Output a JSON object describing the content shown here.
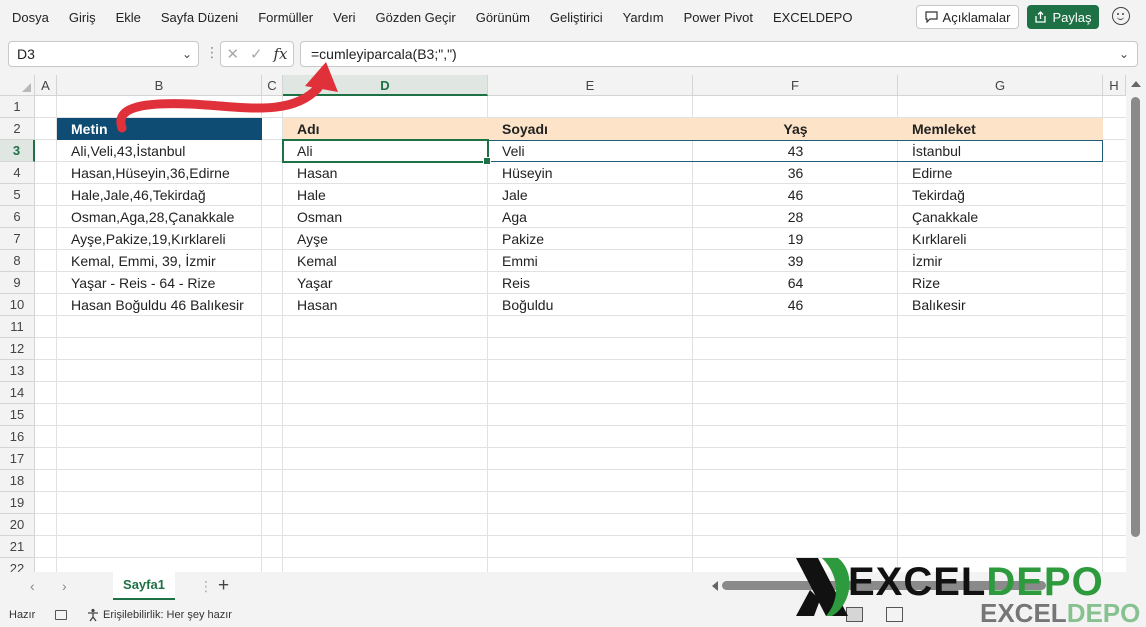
{
  "menu": [
    "Dosya",
    "Giriş",
    "Ekle",
    "Sayfa Düzeni",
    "Formüller",
    "Veri",
    "Gözden Geçir",
    "Görünüm",
    "Geliştirici",
    "Yardım",
    "Power Pivot",
    "EXCELDEPO"
  ],
  "header_buttons": {
    "comments": "Açıklamalar",
    "share": "Paylaş"
  },
  "formula_bar": {
    "name_box": "D3",
    "formula": "=cumleyiparcala(B3;\",\")",
    "fx_label": "fx"
  },
  "columns": [
    "A",
    "B",
    "C",
    "D",
    "E",
    "F",
    "G",
    "H"
  ],
  "rows": [
    "1",
    "2",
    "3",
    "4",
    "5",
    "6",
    "7",
    "8",
    "9",
    "10",
    "11",
    "12",
    "13",
    "14",
    "15",
    "16",
    "17",
    "18",
    "19",
    "20",
    "21",
    "22"
  ],
  "selected_cell": {
    "column": "D",
    "row": "3"
  },
  "source_header": "Metin",
  "source_rows": [
    "Ali,Veli,43,İstanbul",
    "Hasan,Hüseyin,36,Edirne",
    "Hale,Jale,46,Tekirdağ",
    "Osman,Aga,28,Çanakkale",
    "Ayşe,Pakize,19,Kırklareli",
    "Kemal, Emmi, 39, İzmir",
    "Yaşar - Reis - 64 - Rize",
    "Hasan Boğuldu 46 Balıkesir"
  ],
  "result_headers": [
    "Adı",
    "Soyadı",
    "Yaş",
    "Memleket"
  ],
  "result_rows": [
    [
      "Ali",
      "Veli",
      "43",
      "İstanbul"
    ],
    [
      "Hasan",
      "Hüseyin",
      "36",
      "Edirne"
    ],
    [
      "Hale",
      "Jale",
      "46",
      "Tekirdağ"
    ],
    [
      "Osman",
      "Aga",
      "28",
      "Çanakkale"
    ],
    [
      "Ayşe",
      "Pakize",
      "19",
      "Kırklareli"
    ],
    [
      "Kemal",
      "Emmi",
      "39",
      "İzmir"
    ],
    [
      "Yaşar",
      "Reis",
      "64",
      "Rize"
    ],
    [
      "Hasan",
      "Boğuldu",
      "46",
      "Balıkesir"
    ]
  ],
  "sheet_tabs": [
    "Sayfa1"
  ],
  "status": {
    "ready": "Hazır",
    "accessibility": "Erişilebilirlik: Her şey hazır"
  },
  "logo": {
    "excel": "EXCEL",
    "depo": "DEPO"
  },
  "colors": {
    "excel_green": "#1e7145",
    "header_blue": "#0e4c74",
    "header_peach": "#fde4c8",
    "arrow_red": "#e0303a",
    "logo_green": "#2e9a3e"
  },
  "icons": {
    "comments": "comment-icon",
    "share": "share-icon",
    "feedback": "smiley-icon",
    "annotation": "curved-arrow"
  }
}
